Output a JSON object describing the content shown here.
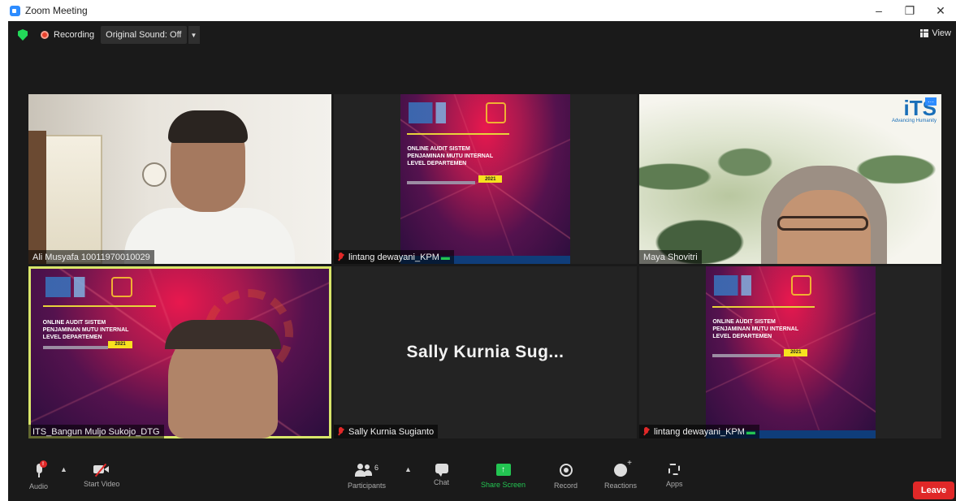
{
  "window": {
    "title": "Zoom Meeting"
  },
  "topbar": {
    "recording_label": "Recording",
    "original_sound_label": "Original Sound: Off",
    "view_label": "View"
  },
  "slide": {
    "title_line1": "ONLINE AUDIT SISTEM",
    "title_line2": "PENJAMINAN MUTU INTERNAL",
    "title_line3": "LEVEL DEPARTEMEN",
    "year": "2021"
  },
  "tiles": [
    {
      "name": "Ali Musyafa 10011970010029",
      "muted": false
    },
    {
      "name": "lintang dewayani_KPM",
      "muted": true
    },
    {
      "name": "Maya Shovitri",
      "muted": false
    },
    {
      "name": "ITS_Bangun Muljo Sukojo_DTG",
      "muted": false,
      "active_speaker": true
    },
    {
      "name": "Sally Kurnia Sugianto",
      "muted": true,
      "big_name": "Sally Kurnia Sug..."
    },
    {
      "name": "lintang dewayani_KPM",
      "muted": true
    }
  ],
  "its_logo": {
    "text": "iTS",
    "tagline": "Advancing Humanity"
  },
  "toolbar": {
    "audio_label": "Audio",
    "mic_badge": "!",
    "video_label": "Start Video",
    "participants_label": "Participants",
    "participants_count": "6",
    "chat_label": "Chat",
    "share_label": "Share Screen",
    "record_label": "Record",
    "reactions_label": "Reactions",
    "apps_label": "Apps",
    "leave_label": "Leave"
  },
  "colors": {
    "background": "#1a1a1a",
    "active_speaker_border": "#d9e66a",
    "leave": "#e02828",
    "share": "#23c552"
  }
}
